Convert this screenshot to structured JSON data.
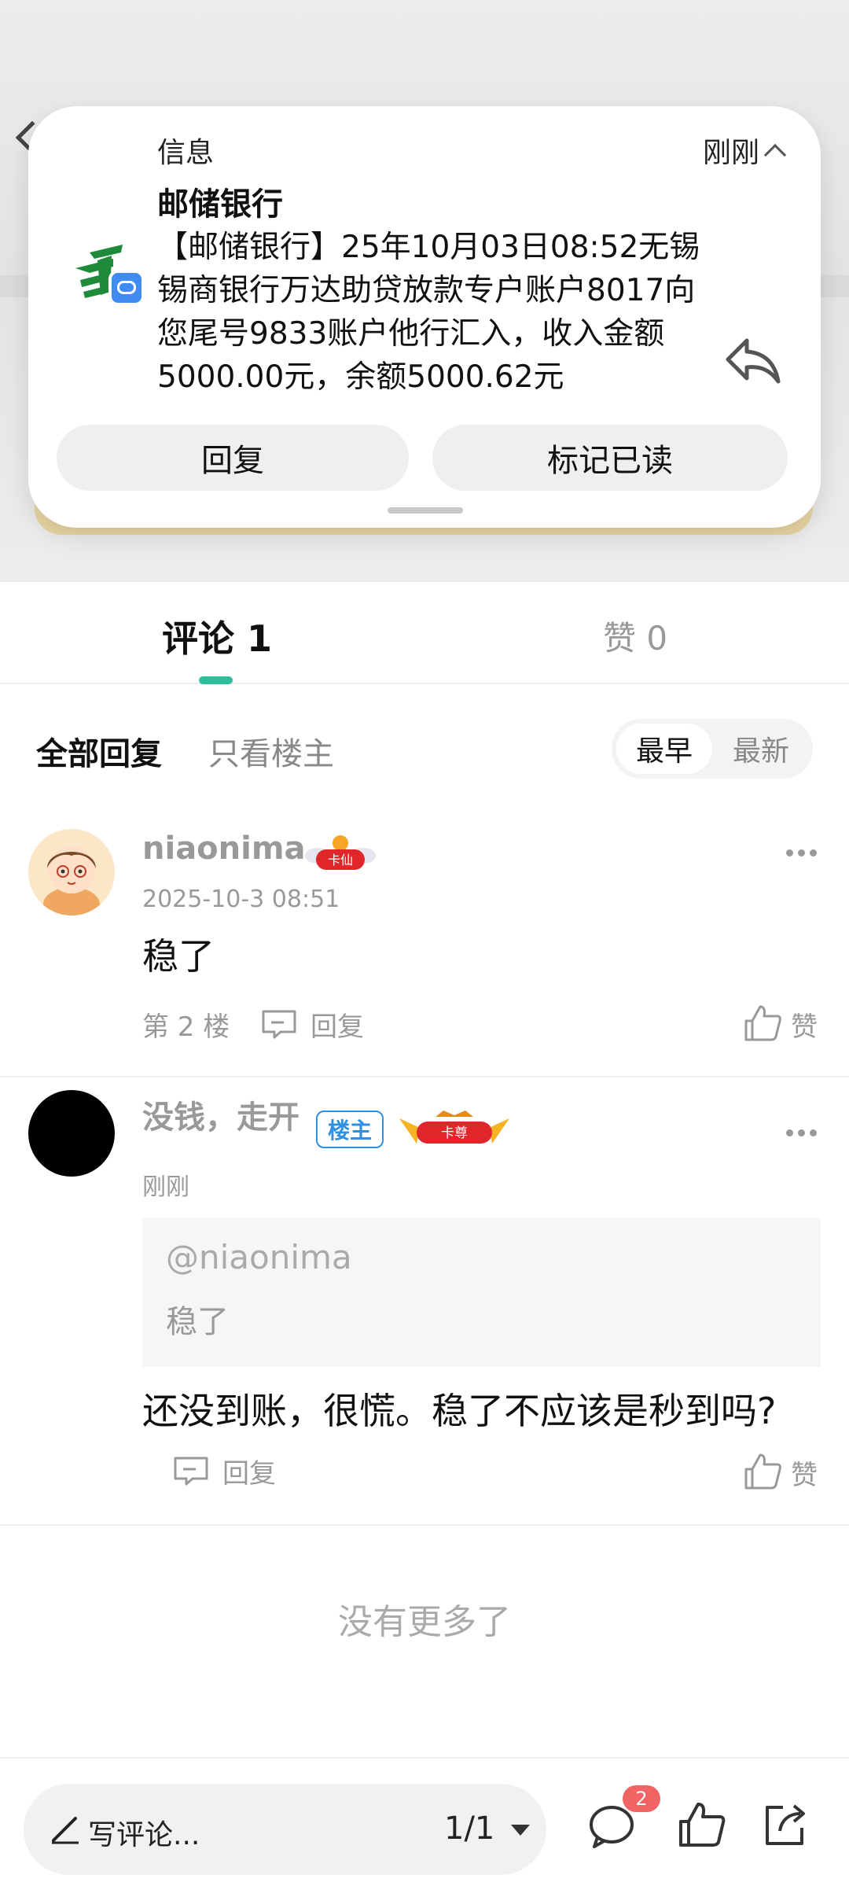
{
  "notification": {
    "app_name": "信息",
    "time": "刚刚",
    "sender": "邮储银行",
    "body": "【邮储银行】25年10月03日08:52无锡锡商银行万达助贷放款专户账户8017向您尾号9833账户他行汇入，收入金额5000.00元，余额5000.62元",
    "reply_label": "回复",
    "mark_read_label": "标记已读"
  },
  "tabs": {
    "comments_label": "评论 1",
    "likes_label": "赞 0"
  },
  "filter": {
    "all_label": "全部回复",
    "op_only_label": "只看楼主",
    "sort_earliest": "最早",
    "sort_newest": "最新"
  },
  "comments": [
    {
      "username": "niaonima",
      "badge": "卡仙",
      "date": "2025-10-3 08:51",
      "text": "稳了",
      "floor": "第 2 楼",
      "reply_label": "回复",
      "like_label": "赞"
    },
    {
      "username": "没钱，走开",
      "op_tag": "楼主",
      "badge": "卡尊",
      "date": "刚刚",
      "quote_user": "@niaonima",
      "quote_text": "稳了",
      "text": "还没到账，很慌。稳了不应该是秒到吗?",
      "reply_label": "回复",
      "like_label": "赞"
    }
  ],
  "no_more_label": "没有更多了",
  "bottom_bar": {
    "write_placeholder": "写评论...",
    "page_indicator": "1/1",
    "comment_count_badge": "2"
  },
  "colors": {
    "accent_teal": "#2fbe9c",
    "op_tag_blue": "#2f8fe0",
    "badge_red": "#f06464",
    "postal_green": "#1e8a3a"
  }
}
